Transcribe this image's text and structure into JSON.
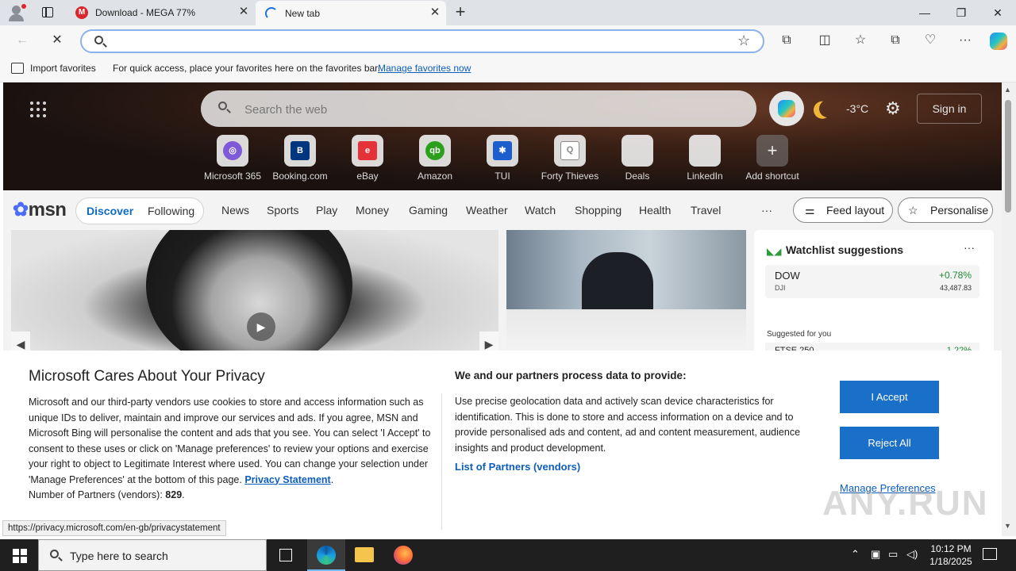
{
  "browser": {
    "tabs": [
      {
        "title": "Download - MEGA 77%",
        "favicon": "M"
      },
      {
        "title": "New tab"
      }
    ],
    "address_placeholder": "",
    "favorites_bar": {
      "import_label": "Import favorites",
      "hint": "For quick access, place your favorites here on the favorites bar.",
      "manage_link": "Manage favorites now"
    },
    "status_url": "https://privacy.microsoft.com/en-gb/privacystatement"
  },
  "newtab": {
    "search_placeholder": "Search the web",
    "weather": {
      "temp": "-3",
      "unit": "°C"
    },
    "signin_label": "Sign in",
    "shortcuts": [
      {
        "label": "Microsoft 365",
        "color": "#7f5ad8",
        "glyph": "◎"
      },
      {
        "label": "Booking.com",
        "color": "#003580",
        "glyph": "B"
      },
      {
        "label": "eBay",
        "color": "#e53238",
        "glyph": "e"
      },
      {
        "label": "Amazon",
        "color": "#2ca01c",
        "glyph": "qb"
      },
      {
        "label": "TUI",
        "color": "#1c5ecd",
        "glyph": "✱"
      },
      {
        "label": "Forty Thieves",
        "color": "#8a8a8a",
        "glyph": "Q"
      },
      {
        "label": "Deals",
        "color": "",
        "glyph": ""
      },
      {
        "label": "LinkedIn",
        "color": "",
        "glyph": ""
      },
      {
        "label": "Add shortcut",
        "color": "",
        "glyph": "+"
      }
    ]
  },
  "msn": {
    "logo": "msn",
    "tabs": [
      "Discover",
      "Following"
    ],
    "nav": [
      "News",
      "Sports",
      "Play",
      "Money",
      "Gaming",
      "Weather",
      "Watch",
      "Shopping",
      "Health",
      "Travel"
    ],
    "more": "···",
    "feed_layout": "Feed layout",
    "personalise": "Personalise",
    "watchlist": {
      "title": "Watchlist suggestions",
      "ticker": {
        "symbol": "DOW",
        "sub": "DJI",
        "change": "+0.78%",
        "price": "43,487.83"
      },
      "suggested_label": "Suggested for you",
      "ticker2": {
        "symbol": "FTSE 250",
        "change": "1.22%"
      }
    }
  },
  "privacy": {
    "title": "Microsoft Cares About Your Privacy",
    "body": "Microsoft and our third-party vendors use cookies to store and access information such as unique IDs to deliver, maintain and improve our services and ads. If you agree, MSN and Microsoft Bing will personalise the content and ads that you see. You can select 'I Accept' to consent to these uses or click on 'Manage preferences' to review your options and exercise your right to object to Legitimate Interest where used.  You can change your selection under 'Manage Preferences' at the bottom of this page.",
    "privacy_link": "Privacy Statement",
    "partners_count_label": "Number of Partners (vendors):",
    "partners_count": "829",
    "right_title": "We and our partners process data to provide:",
    "right_body": "Use precise geolocation data and actively scan device characteristics for identification. This is done to store and access information on a device and to provide personalised ads and content, ad and content measurement, audience insights and product development.",
    "partners_link": "List of Partners (vendors)",
    "accept": "I Accept",
    "reject": "Reject All",
    "manage": "Manage Preferences"
  },
  "taskbar": {
    "search_placeholder": "Type here to search",
    "time": "10:12 PM",
    "date": "1/18/2025"
  },
  "watermark": "ANY.RUN"
}
